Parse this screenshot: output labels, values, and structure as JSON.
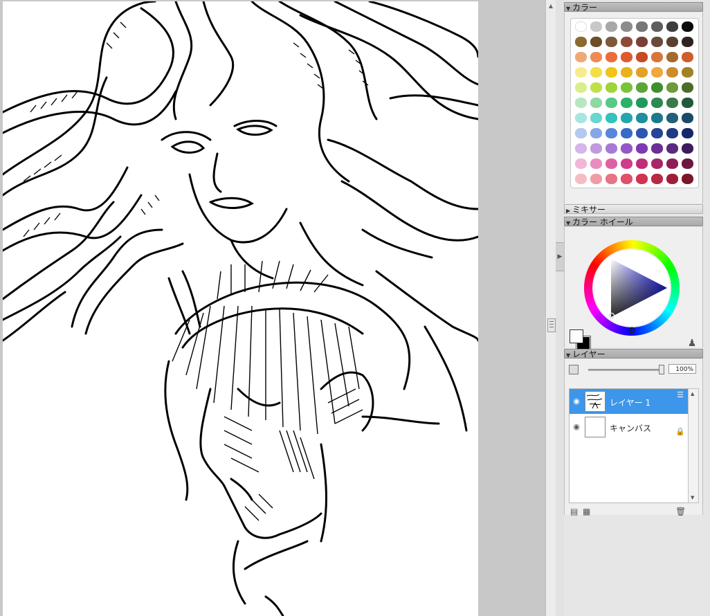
{
  "panels": {
    "color": {
      "title": "カラー"
    },
    "mixer": {
      "title": "ミキサー"
    },
    "wheel": {
      "title": "カラー ホイール"
    },
    "layers": {
      "title": "レイヤー",
      "opacity": "100%",
      "items": [
        {
          "name": "レイヤー 1",
          "selected": true
        },
        {
          "name": "キャンバス",
          "selected": false
        }
      ]
    }
  },
  "colors": {
    "accent_selected": "#3d96ea",
    "foreground": "#ffffff",
    "background": "#000000"
  },
  "swatches": [
    [
      "#ffffff",
      "#c8c8c8",
      "#a8a8a8",
      "#8c8c8c",
      "#777777",
      "#5e5e5e",
      "#3e3e3e",
      "#0a0a0a"
    ],
    [
      "#8a6a2f",
      "#6c4e2a",
      "#7a5a3a",
      "#8d4b37",
      "#7a4037",
      "#6a4a3a",
      "#5b4030",
      "#2f2220"
    ],
    [
      "#f1a878",
      "#ee8a58",
      "#e86f3c",
      "#e05a2f",
      "#c64a24",
      "#d8773a",
      "#a56a2d",
      "#cf5d2b"
    ],
    [
      "#f6ec8c",
      "#f2df46",
      "#f0c419",
      "#e8b21a",
      "#e0a228",
      "#f0a73c",
      "#cc8c2a",
      "#a38223"
    ],
    [
      "#d8ee8a",
      "#c0e04a",
      "#9fd53a",
      "#77c43b",
      "#5aa637",
      "#3f8f2d",
      "#6e9a3a",
      "#4c6d2a"
    ],
    [
      "#b8e6c0",
      "#8ed8a2",
      "#58c887",
      "#2cb06a",
      "#1f9a5a",
      "#2a8a50",
      "#3a7a4a",
      "#215a3a"
    ],
    [
      "#a6e6e2",
      "#6ad6d0",
      "#36c2bc",
      "#23a6b0",
      "#1e8ea0",
      "#1c7a8c",
      "#235f7a",
      "#1a4a6a"
    ],
    [
      "#b4c8f0",
      "#86a6e8",
      "#5a86da",
      "#3a6ac8",
      "#2e56b0",
      "#284496",
      "#1f3a80",
      "#15286a"
    ],
    [
      "#d4b6ea",
      "#c09ae0",
      "#a67ad4",
      "#9458c6",
      "#7e3ab0",
      "#6a2e96",
      "#5a2a80",
      "#3e1c5c"
    ],
    [
      "#f2b6d6",
      "#ea8cc0",
      "#e060a6",
      "#d23c8c",
      "#c02c78",
      "#a82666",
      "#8e1f56",
      "#6a1840"
    ],
    [
      "#f6bcc4",
      "#f09ca8",
      "#e87486",
      "#e05068",
      "#d03450",
      "#b82a44",
      "#a01f38",
      "#7a182a"
    ]
  ]
}
